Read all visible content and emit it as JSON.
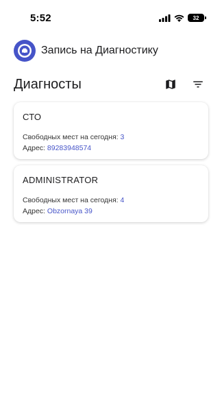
{
  "status": {
    "time": "5:52",
    "battery": "32"
  },
  "app": {
    "title": "Запись на Диагностику",
    "logo_icon": "car-calendar-icon",
    "accent_color": "#4654c8"
  },
  "section": {
    "title": "Диагносты",
    "map_icon": "map-icon",
    "filter_icon": "filter-icon"
  },
  "cards": [
    {
      "title": "СТО",
      "slots_label": "Свободных мест на сегодня:",
      "slots_value": "3",
      "address_label": "Адрес:",
      "address_value": "89283948574"
    },
    {
      "title": "ADMINISTRATOR",
      "slots_label": "Свободных мест на сегодня:",
      "slots_value": "4",
      "address_label": "Адрес:",
      "address_value": "Obzornaya 39"
    }
  ]
}
